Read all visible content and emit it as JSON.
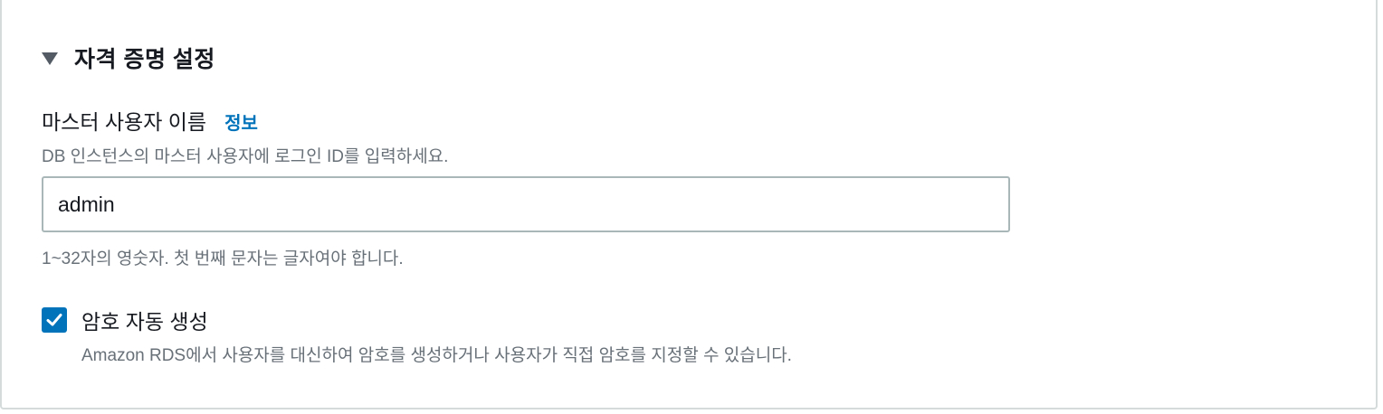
{
  "section": {
    "title": "자격 증명 설정",
    "expanded_icon": "caret-down-icon"
  },
  "master_username": {
    "label": "마스터 사용자 이름",
    "info_link": "정보",
    "description": "DB 인스턴스의 마스터 사용자에 로그인 ID를 입력하세요.",
    "value": "admin",
    "constraint": "1~32자의 영숫자. 첫 번째 문자는 글자여야 합니다."
  },
  "auto_password": {
    "checked": true,
    "label": "암호 자동 생성",
    "description": "Amazon RDS에서 사용자를 대신하여 암호를 생성하거나 사용자가 직접 암호를 지정할 수 있습니다.",
    "check_icon": "checkmark-icon"
  },
  "colors": {
    "accent": "#0073bb",
    "text": "#16191f",
    "secondary_text": "#687078",
    "border": "#aab7b8"
  }
}
